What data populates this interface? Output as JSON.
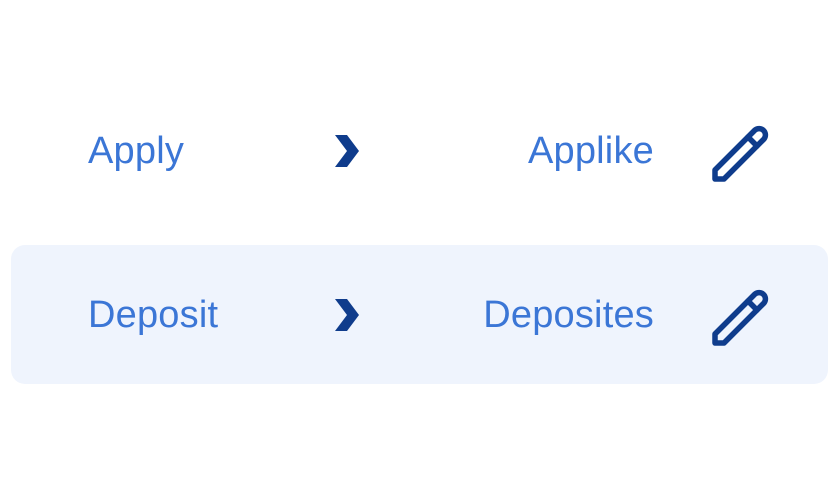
{
  "colors": {
    "text_accent": "#3b76d6",
    "icon_dark": "#0f3c8c",
    "highlight_row_bg": "#eff4fd",
    "background": "#ffffff"
  },
  "replacements": [
    {
      "source": "Apply",
      "target": "Applike",
      "arrow_icon": "chevron-right-icon",
      "edit_icon": "pencil-icon",
      "highlighted": false
    },
    {
      "source": "Deposit",
      "target": "Deposites",
      "arrow_icon": "chevron-right-icon",
      "edit_icon": "pencil-icon",
      "highlighted": true
    }
  ]
}
